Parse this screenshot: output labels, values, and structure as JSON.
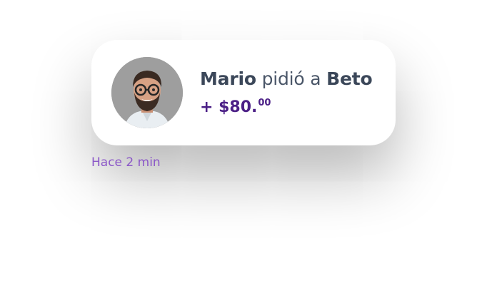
{
  "notification": {
    "sender": "Mario",
    "action": "pidió a",
    "recipient": "Beto",
    "amount_main": "+ $80.",
    "amount_cents": "00",
    "avatar_icon": "user-avatar-photo"
  },
  "timestamp": "Hace 2 min",
  "colors": {
    "accent": "#4b1f86",
    "timestamp": "#8b57c8",
    "name_text": "#3b4759"
  }
}
